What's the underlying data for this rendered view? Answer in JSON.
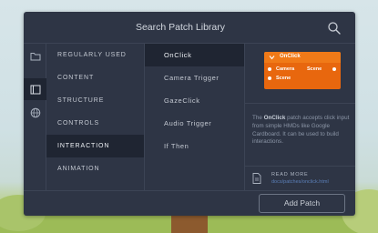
{
  "header": {
    "title": "Search Patch Library",
    "search_icon": "search-icon"
  },
  "iconbar": {
    "items": [
      {
        "icon": "folder-icon"
      },
      {
        "icon": "film-icon"
      },
      {
        "icon": "globe-icon"
      }
    ],
    "active_index": 1
  },
  "categories": {
    "items": [
      "REGULARLY USED",
      "CONTENT",
      "STRUCTURE",
      "CONTROLS",
      "INTERACTION",
      "ANIMATION"
    ],
    "active_index": 4
  },
  "patches": {
    "items": [
      "OnClick",
      "Camera Trigger",
      "GazeClick",
      "Audio Trigger",
      "If Then"
    ],
    "active_index": 0
  },
  "detail": {
    "node": {
      "title": "OnClick",
      "inputs": [
        "Camera",
        "Scene"
      ],
      "output": "Scene",
      "color": "#e8670e"
    },
    "description_prefix": "The ",
    "description_name": "OnClick",
    "description_rest": " patch accepts click input from simple HMDs like Google Cardboard. It can be used to build interactions.",
    "read_more_title": "READ MORE",
    "read_more_link": "docs/patches/onclick.html"
  },
  "footer": {
    "add_label": "Add Patch"
  },
  "colors": {
    "panel": "#2e3545",
    "active_row": "#1f2532",
    "accent": "#f07a18",
    "link": "#5b7fb8"
  }
}
